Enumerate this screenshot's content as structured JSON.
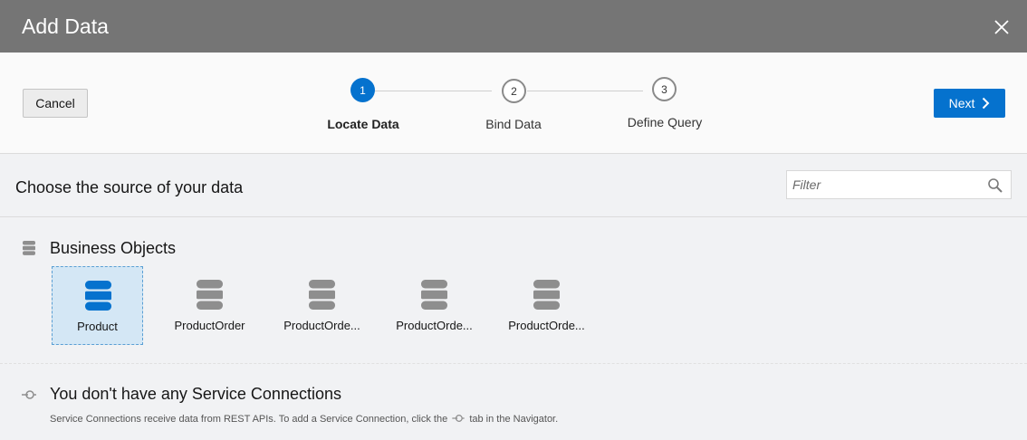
{
  "dialog": {
    "title": "Add Data"
  },
  "toolbar": {
    "cancel_label": "Cancel",
    "next_label": "Next"
  },
  "steps": [
    {
      "number": "1",
      "label": "Locate Data",
      "active": true
    },
    {
      "number": "2",
      "label": "Bind Data",
      "active": false
    },
    {
      "number": "3",
      "label": "Define Query",
      "active": false
    }
  ],
  "source": {
    "title": "Choose the source of your data",
    "filter_placeholder": "Filter"
  },
  "business_objects": {
    "title": "Business Objects",
    "items": [
      {
        "label": "Product",
        "selected": true
      },
      {
        "label": "ProductOrder",
        "selected": false
      },
      {
        "label": "ProductOrde...",
        "selected": false
      },
      {
        "label": "ProductOrde...",
        "selected": false
      },
      {
        "label": "ProductOrde...",
        "selected": false
      }
    ]
  },
  "service_connections": {
    "title": "You don't have any Service Connections",
    "desc_before": "Service Connections receive data from REST APIs. To add a Service Connection, click the",
    "desc_after": "tab in the Navigator."
  },
  "colors": {
    "accent": "#0572ce",
    "header_bg": "#757575",
    "selected_bg": "#d4e7f5",
    "icon_gray": "#8e8e8e"
  },
  "icons": {
    "close": "close-icon",
    "next": "chevron-right-icon",
    "search": "search-icon",
    "database": "database-icon",
    "service_connection": "plug-icon"
  }
}
